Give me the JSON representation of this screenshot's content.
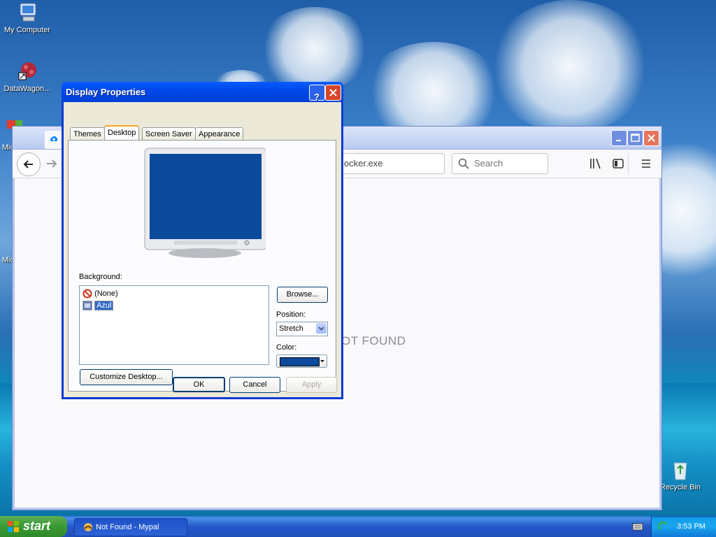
{
  "desktop": {
    "icons": [
      {
        "label": "My Computer",
        "icon": "my-computer-icon"
      },
      {
        "label": "DataWagon...",
        "icon": "datawagon-icon"
      },
      {
        "label": "Mic",
        "icon": "app-icon"
      },
      {
        "label": "Mic",
        "icon": "app-icon"
      },
      {
        "label": "Recycle Bin",
        "icon": "recycle-bin-icon"
      }
    ]
  },
  "browser": {
    "url_fragment": "locker.exe",
    "search_placeholder": "Search",
    "page_message": "OT FOUND"
  },
  "dialog": {
    "title": "Display Properties",
    "tabs": [
      "Themes",
      "Desktop",
      "Screen Saver",
      "Appearance"
    ],
    "active_tab": "Desktop",
    "background_label": "Background:",
    "background_items": [
      "(None)",
      "Azul"
    ],
    "selected_background": "Azul",
    "browse_label": "Browse...",
    "position_label": "Position:",
    "position_value": "Stretch",
    "color_label": "Color:",
    "color_value": "#0b4a9c",
    "customize_label": "Customize Desktop...",
    "ok_label": "OK",
    "cancel_label": "Cancel",
    "apply_label": "Apply",
    "monitor_preview_color": "#0b4a9c"
  },
  "taskbar": {
    "start_label": "start",
    "task_label": "Not Found - Mypal",
    "clock": "3:53 PM"
  }
}
